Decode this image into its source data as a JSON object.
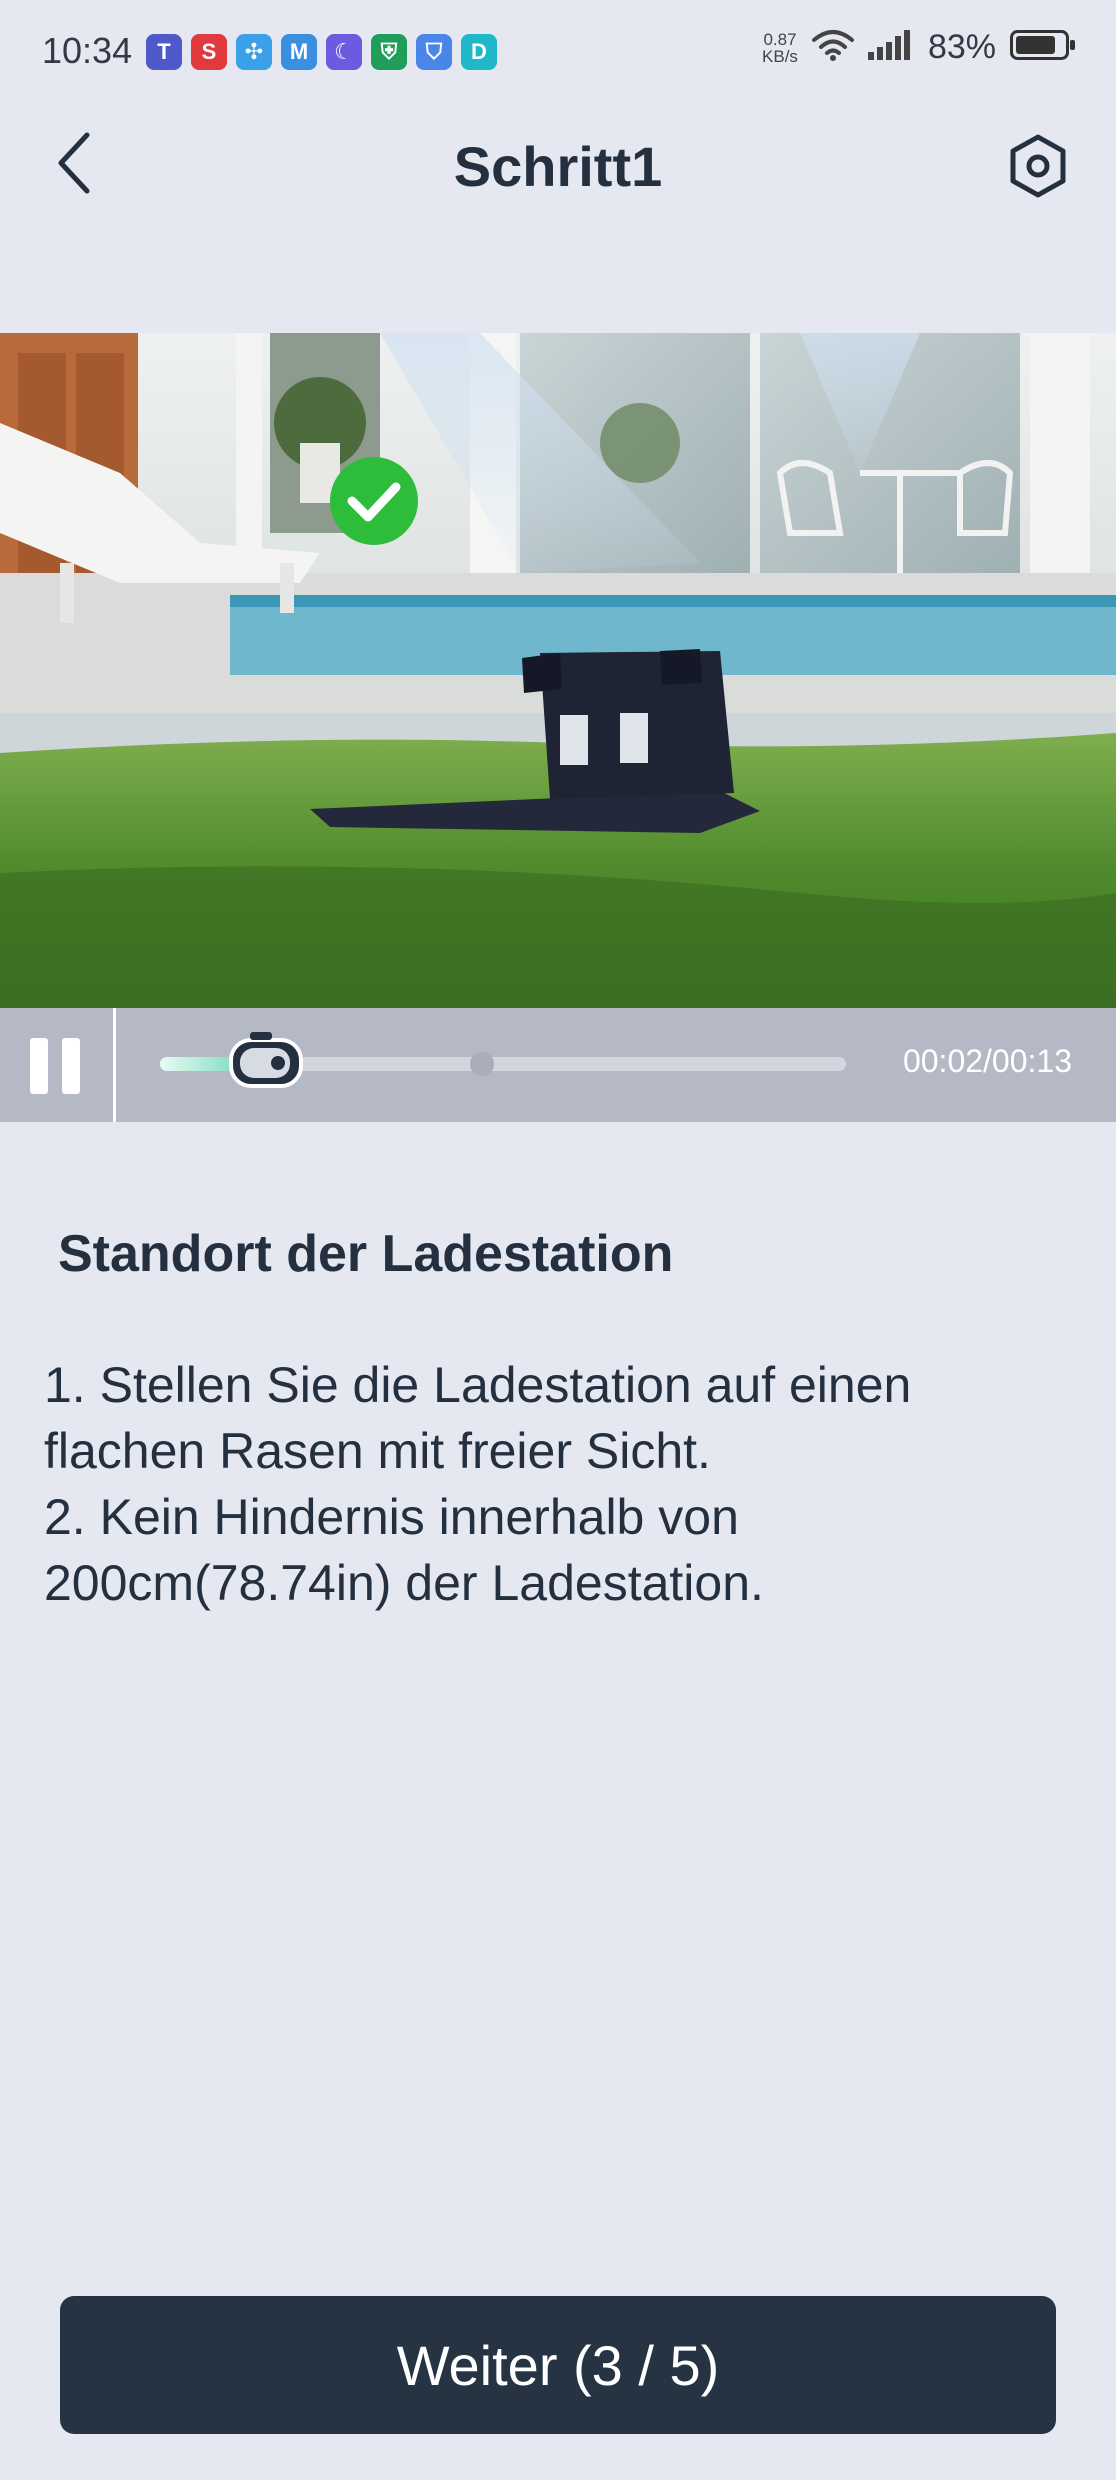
{
  "status_bar": {
    "time": "10:34",
    "notification_icons": [
      {
        "name": "teams-icon",
        "color": "#5059c9",
        "glyph": "T"
      },
      {
        "name": "s-app-icon",
        "color": "#e03a3e",
        "glyph": "S"
      },
      {
        "name": "fan-app-icon",
        "color": "#3aa0e8",
        "glyph": "✣"
      },
      {
        "name": "m-app-icon",
        "color": "#3b8fe0",
        "glyph": "M"
      },
      {
        "name": "moon-app-icon",
        "color": "#6a5be0",
        "glyph": "☾"
      },
      {
        "name": "shield-lock-app-icon",
        "color": "#1f9e5a",
        "glyph": "⛨"
      },
      {
        "name": "shield-app-icon",
        "color": "#4a86e8",
        "glyph": "⛉"
      },
      {
        "name": "d-app-icon",
        "color": "#1fb8c8",
        "glyph": "D"
      }
    ],
    "net_speed_value": "0.87",
    "net_speed_unit": "KB/s",
    "battery_percent": "83%",
    "battery_level": 0.83
  },
  "header": {
    "title": "Schritt1"
  },
  "player": {
    "time": "00:02/00:13",
    "progress": 0.154,
    "buffered_marker": 0.47
  },
  "content": {
    "section_title": "Standort der Ladestation",
    "instruction_1": "1. Stellen Sie die Ladestation auf einen flachen Rasen mit freier Sicht.",
    "instruction_2": "2. Kein Hindernis innerhalb von 200cm(78.74in) der Ladestation."
  },
  "footer": {
    "next_button_label": "Weiter (3 / 5)"
  },
  "colors": {
    "background": "#e5e8f1",
    "primary_dark": "#263342",
    "progress_accent": "#5bd3ae",
    "check_green": "#2ebd3a"
  }
}
